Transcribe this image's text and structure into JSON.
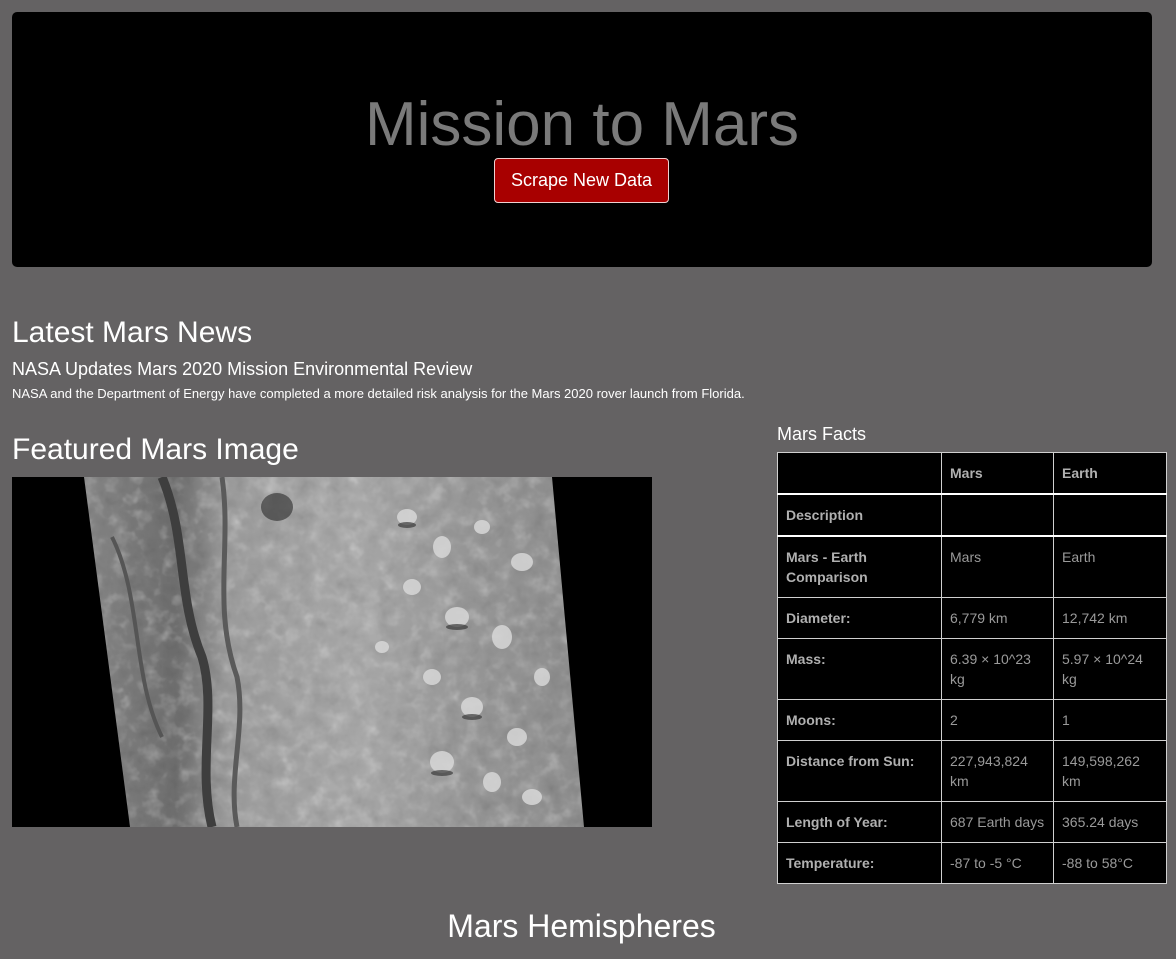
{
  "jumbotron": {
    "title": "Mission to Mars",
    "button_label": "Scrape New Data"
  },
  "news": {
    "heading": "Latest Mars News",
    "title": "NASA Updates Mars 2020 Mission Environmental Review",
    "paragraph": "NASA and the Department of Energy have completed a more detailed risk analysis for the Mars 2020 rover launch from Florida."
  },
  "featured": {
    "heading": "Featured Mars Image"
  },
  "facts": {
    "heading": "Mars Facts",
    "columns": [
      "",
      "Mars",
      "Earth"
    ],
    "description_label": "Description",
    "rows": [
      {
        "label": "Mars - Earth Comparison",
        "mars": "Mars",
        "earth": "Earth"
      },
      {
        "label": "Diameter:",
        "mars": "6,779 km",
        "earth": "12,742 km"
      },
      {
        "label": "Mass:",
        "mars": "6.39 × 10^23 kg",
        "earth": "5.97 × 10^24 kg"
      },
      {
        "label": "Moons:",
        "mars": "2",
        "earth": "1"
      },
      {
        "label": "Distance from Sun:",
        "mars": "227,943,824 km",
        "earth": "149,598,262 km"
      },
      {
        "label": "Length of Year:",
        "mars": "687 Earth days",
        "earth": "365.24 days"
      },
      {
        "label": "Temperature:",
        "mars": "-87 to -5 °C",
        "earth": "-88 to 58°C"
      }
    ]
  },
  "hemispheres": {
    "heading": "Mars Hemispheres"
  },
  "colors": {
    "page_background": "#646263",
    "jumbotron_background": "#000000",
    "title_color": "#7a7a7a",
    "button_background": "#a80000"
  }
}
